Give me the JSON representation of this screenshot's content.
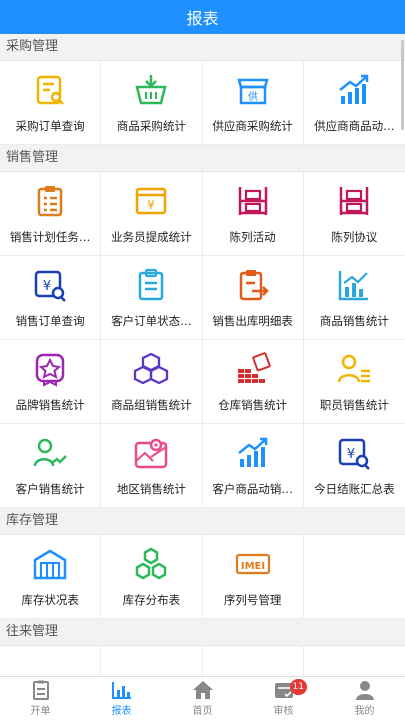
{
  "header": {
    "title": "报表"
  },
  "sections": [
    {
      "title": "采购管理",
      "items": [
        "采购订单查询",
        "商品采购统计",
        "供应商采购统计",
        "供应商商品动…"
      ]
    },
    {
      "title": "销售管理",
      "items": [
        "销售计划任务…",
        "业务员提成统计",
        "陈列活动",
        "陈列协议",
        "销售订单查询",
        "客户订单状态…",
        "销售出库明细表",
        "商品销售统计",
        "品牌销售统计",
        "商品组销售统计",
        "仓库销售统计",
        "职员销售统计",
        "客户销售统计",
        "地区销售统计",
        "客户商品动销…",
        "今日结账汇总表"
      ]
    },
    {
      "title": "库存管理",
      "items": [
        "库存状况表",
        "库存分布表",
        "序列号管理"
      ]
    },
    {
      "title": "往来管理",
      "items": []
    }
  ],
  "icons": {
    "purchase_order": "¥",
    "sales_icon_text": "¥",
    "vendor_stall": "供",
    "imei": "IMEI"
  },
  "tabbar": {
    "items": [
      {
        "label": "开单"
      },
      {
        "label": "报表"
      },
      {
        "label": "首页"
      },
      {
        "label": "审核",
        "badge": "11"
      },
      {
        "label": "我的"
      }
    ]
  },
  "colors": {
    "primary": "#1e90ff",
    "badge": "#e53935"
  }
}
